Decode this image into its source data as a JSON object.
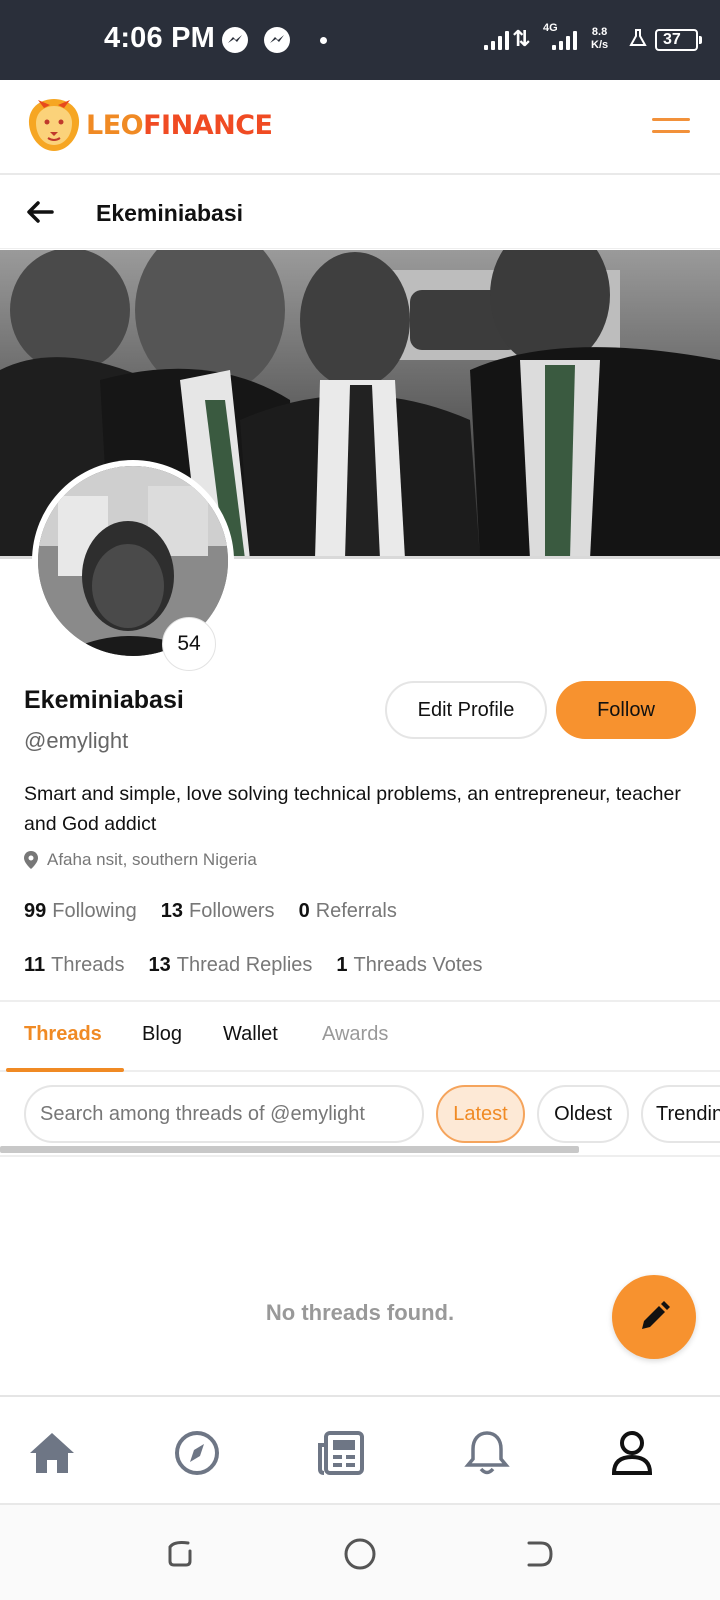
{
  "status_bar": {
    "time": "4:06 PM",
    "network": "4G",
    "speed_value": "8.8",
    "speed_unit": "K/s",
    "battery": "37",
    "icons": [
      "messenger-icon",
      "messenger-icon",
      "signal-icon",
      "data-arrows-icon",
      "signal-icon",
      "flask-icon",
      "battery-icon"
    ]
  },
  "app": {
    "logo_leo": "LEO",
    "logo_finance": "FINANCE",
    "accent_color": "#f7922f"
  },
  "header": {
    "title": "Ekeminiabasi"
  },
  "profile": {
    "reputation": "54",
    "name": "Ekeminiabasi",
    "handle": "@emylight",
    "bio": "Smart and simple, love solving technical problems, an entrepreneur, teacher and God addict",
    "location": "Afaha nsit, southern Nigeria",
    "edit_label": "Edit Profile",
    "follow_label": "Follow"
  },
  "stats": {
    "following_count": "99",
    "following_label": "Following",
    "followers_count": "13",
    "followers_label": "Followers",
    "referrals_count": "0",
    "referrals_label": "Referrals",
    "threads_count": "11",
    "threads_label": "Threads",
    "replies_count": "13",
    "replies_label": "Thread Replies",
    "votes_count": "1",
    "votes_label": "Threads Votes"
  },
  "tabs": [
    {
      "label": "Threads",
      "active": true
    },
    {
      "label": "Blog",
      "active": false
    },
    {
      "label": "Wallet",
      "active": false
    },
    {
      "label": "Awards",
      "active": false
    }
  ],
  "search": {
    "placeholder": "Search among threads of @emylight"
  },
  "filters": [
    {
      "label": "Latest",
      "active": true
    },
    {
      "label": "Oldest",
      "active": false
    },
    {
      "label": "Trending",
      "active": false
    }
  ],
  "empty_state": "No threads found.",
  "bottom_nav": [
    "home-icon",
    "explore-icon",
    "news-icon",
    "bell-icon",
    "profile-icon"
  ]
}
